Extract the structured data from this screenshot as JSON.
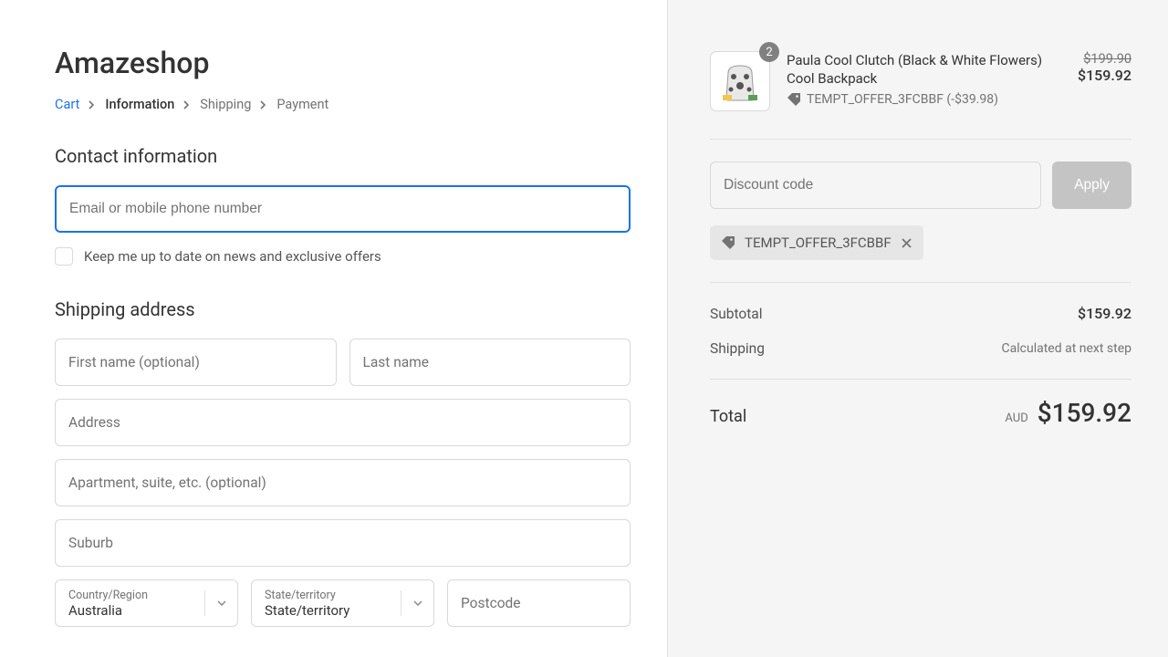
{
  "brand": "Amazeshop",
  "breadcrumb": {
    "cart": "Cart",
    "information": "Information",
    "shipping": "Shipping",
    "payment": "Payment"
  },
  "contact": {
    "title": "Contact information",
    "email_placeholder": "Email or mobile phone number",
    "newsletter_label": "Keep me up to date on news and exclusive offers"
  },
  "shipping": {
    "title": "Shipping address",
    "first_name_placeholder": "First name (optional)",
    "last_name_placeholder": "Last name",
    "address_placeholder": "Address",
    "apartment_placeholder": "Apartment, suite, etc. (optional)",
    "suburb_placeholder": "Suburb",
    "country_label": "Country/Region",
    "country_value": "Australia",
    "state_label": "State/territory",
    "state_value": "State/territory",
    "postcode_placeholder": "Postcode"
  },
  "cart": {
    "qty": "2",
    "title": "Paula Cool Clutch (Black & White Flowers) Cool Backpack",
    "discount_tag": "TEMPT_OFFER_3FCBBF (-$39.98)",
    "old_price": "$199.90",
    "new_price": "$159.92"
  },
  "discount": {
    "placeholder": "Discount code",
    "apply": "Apply",
    "applied_code": "TEMPT_OFFER_3FCBBF"
  },
  "summary": {
    "subtotal_label": "Subtotal",
    "subtotal_value": "$159.92",
    "shipping_label": "Shipping",
    "shipping_value": "Calculated at next step",
    "total_label": "Total",
    "currency": "AUD",
    "total_value": "$159.92"
  }
}
